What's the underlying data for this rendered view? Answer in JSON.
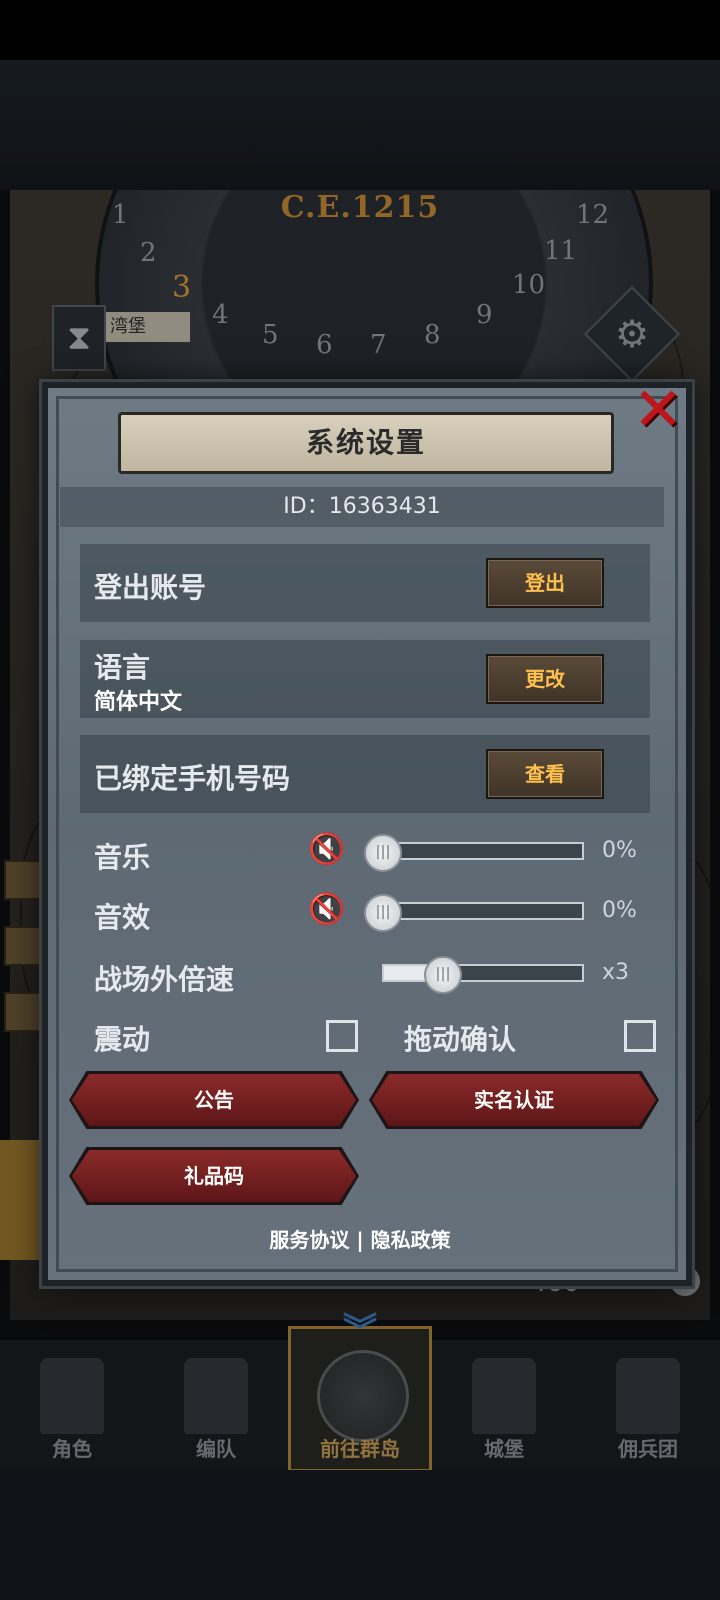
{
  "backdrop": {
    "year": "C.E.1215",
    "dial_numbers": [
      "1",
      "2",
      "3",
      "4",
      "5",
      "6",
      "7",
      "8",
      "9",
      "10",
      "11",
      "12"
    ],
    "active_number": "3",
    "location_tag": "湾堡",
    "resource_value": "460"
  },
  "dialog": {
    "title": "系统设置",
    "id_text": "ID：16363431",
    "rows": {
      "logout": {
        "label": "登出账号",
        "button": "登出"
      },
      "language": {
        "label": "语言",
        "value": "简体中文",
        "button": "更改"
      },
      "phone": {
        "label": "已绑定手机号码",
        "button": "查看"
      }
    },
    "settings": {
      "music": {
        "label": "音乐",
        "value": 0,
        "value_text": "0%"
      },
      "sfx": {
        "label": "音效",
        "value": 0,
        "value_text": "0%"
      },
      "speed": {
        "label": "战场外倍速",
        "value_text": "x3"
      },
      "vibration": {
        "label": "震动",
        "checked": false
      },
      "drag_confirm": {
        "label": "拖动确认",
        "checked": false
      }
    },
    "buttons": {
      "announcement": "公告",
      "real_name": "实名认证",
      "gift_code": "礼品码"
    },
    "footer": {
      "service": "服务协议",
      "separator": "|",
      "privacy": "隐私政策"
    }
  },
  "tabbar": [
    {
      "label": "角色",
      "active": false
    },
    {
      "label": "编队",
      "active": false
    },
    {
      "label": "前往群岛",
      "active": true
    },
    {
      "label": "城堡",
      "active": false
    },
    {
      "label": "佣兵团",
      "active": false
    }
  ],
  "colors": {
    "accent_gold": "#ffc04d",
    "close_red": "#c0141a",
    "button_red": "#8a2a2a"
  }
}
